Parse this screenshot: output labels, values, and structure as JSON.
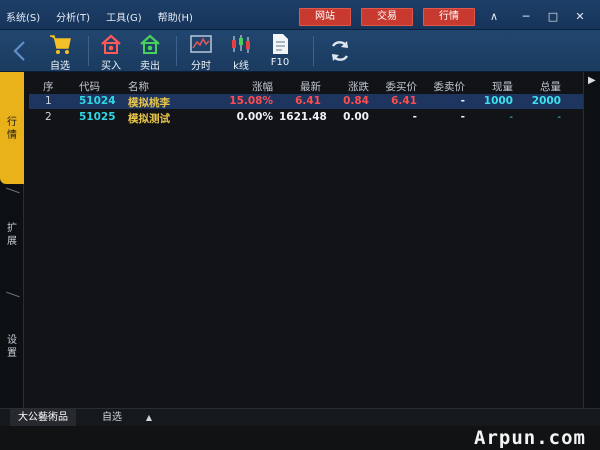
{
  "menu": [
    "系统(S)",
    "分析(T)",
    "工具(G)",
    "帮助(H)"
  ],
  "topbar_buttons": [
    "网站",
    "交易",
    "行情"
  ],
  "window_controls": {
    "collapse": "∧",
    "minimize": "─",
    "maximize": "□",
    "close": "✕"
  },
  "toolbar": {
    "items": [
      {
        "label": "自选",
        "icon": "cart-icon"
      },
      {
        "label": "买入",
        "icon": "buy-house-icon"
      },
      {
        "label": "卖出",
        "icon": "sell-house-icon"
      },
      {
        "label": "分时",
        "icon": "timeshare-chart-icon"
      },
      {
        "label": "k线",
        "icon": "candlestick-icon"
      },
      {
        "label": "F10",
        "icon": "document-icon"
      }
    ],
    "refresh_icon": "refresh-icon",
    "back_icon": "back-arrow-icon"
  },
  "left_tabs": [
    "行情",
    "扩展",
    "设置"
  ],
  "table": {
    "headers": [
      "序",
      "代码",
      "名称",
      "涨幅",
      "最新",
      "涨跌",
      "委买价",
      "委卖价",
      "现量",
      "总量"
    ],
    "rows": [
      [
        "1",
        "51024",
        "模拟桃李",
        "15.08%",
        "6.41",
        "0.84",
        "6.41",
        "-",
        "1000",
        "2000"
      ],
      [
        "2",
        "51025",
        "模拟测试",
        "0.00%",
        "1621.48",
        "0.00",
        "-",
        "-",
        "-",
        "-"
      ]
    ]
  },
  "bottom_tabs": [
    "大公藝術品",
    "自选",
    "▲"
  ],
  "watermark": "Arpun.com",
  "colors": {
    "accent_red": "#c8392f",
    "active_tab": "#e9b21b",
    "selected_row": "#1e3560"
  }
}
